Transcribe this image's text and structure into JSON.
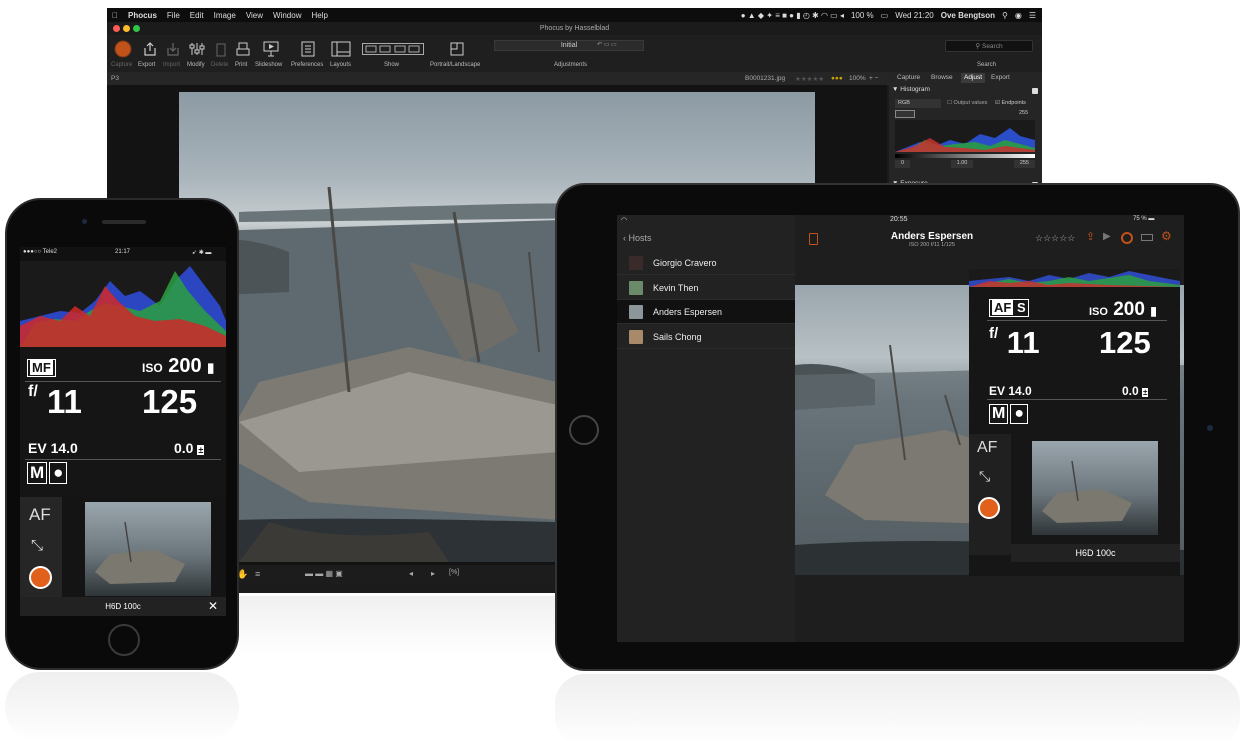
{
  "desktop": {
    "menubar": {
      "app": "Phocus",
      "items": [
        "File",
        "Edit",
        "Image",
        "View",
        "Window",
        "Help"
      ],
      "battery": "100 %",
      "clock": "Wed 21:20",
      "user": "Ove Bengtson"
    },
    "window_title": "Phocus by Hasselblad",
    "toolbar": {
      "capture": "Capture",
      "export": "Export",
      "import": "Import",
      "modify": "Modify",
      "delete": "Delete",
      "print": "Print",
      "slideshow": "Slideshow",
      "preferences": "Preferences",
      "layouts": "Layouts",
      "show": "Show",
      "portrait_landscape": "Portrait/Landscape",
      "adjustments": "Adjustments",
      "preset_value": "Initial",
      "search_placeholder": "Search",
      "search_label": "Search"
    },
    "infobar": {
      "left": "P3",
      "filename": "B0001231.jpg",
      "zoom": "100%"
    },
    "panel": {
      "tabs": [
        "Capture",
        "Browse",
        "Adjust",
        "Export"
      ],
      "histogram_title": "Histogram",
      "channel": "RGB",
      "output_values": "Output values",
      "endpoints": "Endpoints",
      "max_value": "255",
      "low": "0",
      "gamma": "1.00",
      "high": "255",
      "exposure_title": "Exposure"
    },
    "accent": "#c0521a"
  },
  "phone": {
    "carrier": "●●●○○ Tele2",
    "time": "21:17",
    "focus_mode": "MF",
    "iso_label": "ISO",
    "iso_value": "200",
    "aperture_prefix": "f/",
    "aperture": "11",
    "shutter": "125",
    "ev": "EV 14.0",
    "exposure_comp": "0.0",
    "mode": "M",
    "af_label": "AF",
    "camera": "H6D 100c"
  },
  "tablet": {
    "time": "20:55",
    "battery": "75 %",
    "back_label": "Hosts",
    "hosts": [
      "Giorgio Cravero",
      "Kevin Then",
      "Anders Espersen",
      "Sails Chong"
    ],
    "selected_host": 2,
    "title": "Anders Espersen",
    "subtitle": "ISO 200  f/11  1/125",
    "focus_mode": "AF",
    "focus_sub": "S",
    "iso_label": "ISO",
    "iso_value": "200",
    "aperture_prefix": "f/",
    "aperture": "11",
    "shutter": "125",
    "ev": "EV 14.0",
    "exposure_comp": "0.0",
    "mode": "M",
    "af_label": "AF",
    "camera": "H6D 100c"
  }
}
